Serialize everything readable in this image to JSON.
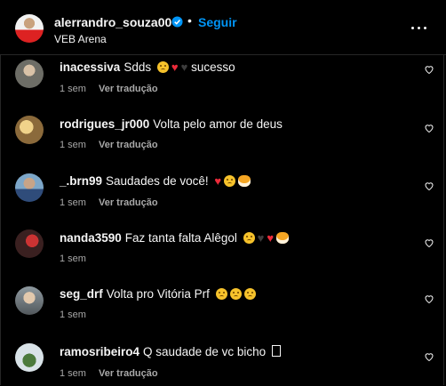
{
  "post": {
    "username": "alerrandro_souza00",
    "follow_label": "Seguir",
    "separator": "•",
    "location": "VEB Arena"
  },
  "comments": [
    {
      "user": "inacessiva",
      "text": "Sdds",
      "emojis": [
        "sad-face",
        "red-heart",
        "black-heart"
      ],
      "after": "sucesso",
      "time": "1 sem",
      "translate": "Ver tradução"
    },
    {
      "user": "rodrigues_jr000",
      "text": "Volta pelo amor de deus",
      "emojis": [],
      "time": "1 sem",
      "translate": "Ver tradução"
    },
    {
      "user": "_.brn99",
      "text": "Saudades de você!",
      "emojis": [
        "red-heart",
        "sad-face",
        "tiger-face"
      ],
      "time": "1 sem",
      "translate": "Ver tradução"
    },
    {
      "user": "nanda3590",
      "text": "Faz tanta falta Alêgol",
      "emojis": [
        "sad-face",
        "black-heart",
        "red-heart",
        "tiger-face"
      ],
      "time": "1 sem",
      "translate": ""
    },
    {
      "user": "seg_drf",
      "text": "Volta pro Vitória Prf",
      "emojis": [
        "sad-face",
        "sad-face",
        "sad-face"
      ],
      "time": "1 sem",
      "translate": ""
    },
    {
      "user": "ramosribeiro4",
      "text": "Q saudade de vc bicho",
      "emojis": [
        "unknown-glyph"
      ],
      "time": "1 sem",
      "translate": "Ver tradução"
    }
  ],
  "colors": {
    "accent": "#0095f6",
    "secondary_text": "#a8a8a8",
    "background": "#000000"
  }
}
